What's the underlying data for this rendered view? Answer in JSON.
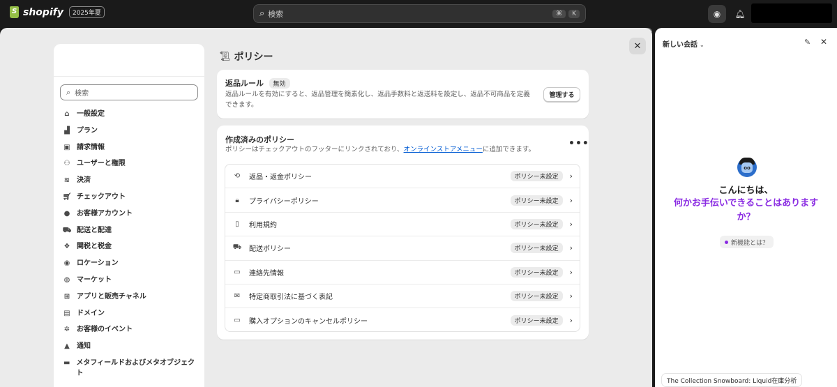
{
  "topbar": {
    "logo_text": "shopify",
    "edition": "2025年夏",
    "search_placeholder": "検索",
    "shortcut_cmd": "⌘",
    "shortcut_key": "K"
  },
  "sidebar": {
    "search_placeholder": "検索",
    "items": [
      {
        "label": "一般設定",
        "icon": "store-icon"
      },
      {
        "label": "プラン",
        "icon": "plan-chart-icon"
      },
      {
        "label": "請求情報",
        "icon": "billing-receipt-icon"
      },
      {
        "label": "ユーザーと権限",
        "icon": "users-icon"
      },
      {
        "label": "決済",
        "icon": "payments-icon"
      },
      {
        "label": "チェックアウト",
        "icon": "cart-icon"
      },
      {
        "label": "お客様アカウント",
        "icon": "person-icon"
      },
      {
        "label": "配送と配達",
        "icon": "truck-icon"
      },
      {
        "label": "関税と税金",
        "icon": "tax-icon"
      },
      {
        "label": "ロケーション",
        "icon": "location-pin-icon"
      },
      {
        "label": "マーケット",
        "icon": "globe-icon"
      },
      {
        "label": "アプリと販売チャネル",
        "icon": "apps-icon"
      },
      {
        "label": "ドメイン",
        "icon": "domain-icon"
      },
      {
        "label": "お客様のイベント",
        "icon": "sparkle-icon"
      },
      {
        "label": "通知",
        "icon": "bell-icon"
      },
      {
        "label": "メタフィールドおよびメタオブジェクト",
        "icon": "metafield-icon"
      }
    ]
  },
  "page": {
    "title": "ポリシー",
    "returns_card": {
      "title": "返品ルール",
      "badge": "無効",
      "description": "返品ルールを有効にすると、返品管理を簡素化し、返品手数料と返送料を設定し、返品不可商品を定義できます。",
      "manage_label": "管理する"
    },
    "policies_card": {
      "title": "作成済みのポリシー",
      "desc_before": "ポリシーはチェックアウトのフッターにリンクされており、",
      "desc_link": "オンラインストアメニュー",
      "desc_after": "に追加できます。",
      "more_label": "•••",
      "rows": [
        {
          "label": "返品・返金ポリシー",
          "status": "ポリシー未設定",
          "icon": "return-icon"
        },
        {
          "label": "プライバシーポリシー",
          "status": "ポリシー未設定",
          "icon": "lock-icon"
        },
        {
          "label": "利用規約",
          "status": "ポリシー未設定",
          "icon": "scroll-icon"
        },
        {
          "label": "配送ポリシー",
          "status": "ポリシー未設定",
          "icon": "truck-icon"
        },
        {
          "label": "連絡先情報",
          "status": "ポリシー未設定",
          "icon": "contact-card-icon"
        },
        {
          "label": "特定商取引法に基づく表記",
          "status": "ポリシー未設定",
          "icon": "mail-open-icon"
        },
        {
          "label": "購入オプションのキャンセルポリシー",
          "status": "ポリシー未設定",
          "icon": "card-cancel-icon"
        }
      ]
    }
  },
  "chat": {
    "header": "新しい会話",
    "greeting_line1": "こんにちは、",
    "greeting_line2": "何かお手伝いできることはありますか？",
    "new_feature": "新機能とは？",
    "suggestion": "The Collection Snowboard: Liquid在庫分析"
  }
}
